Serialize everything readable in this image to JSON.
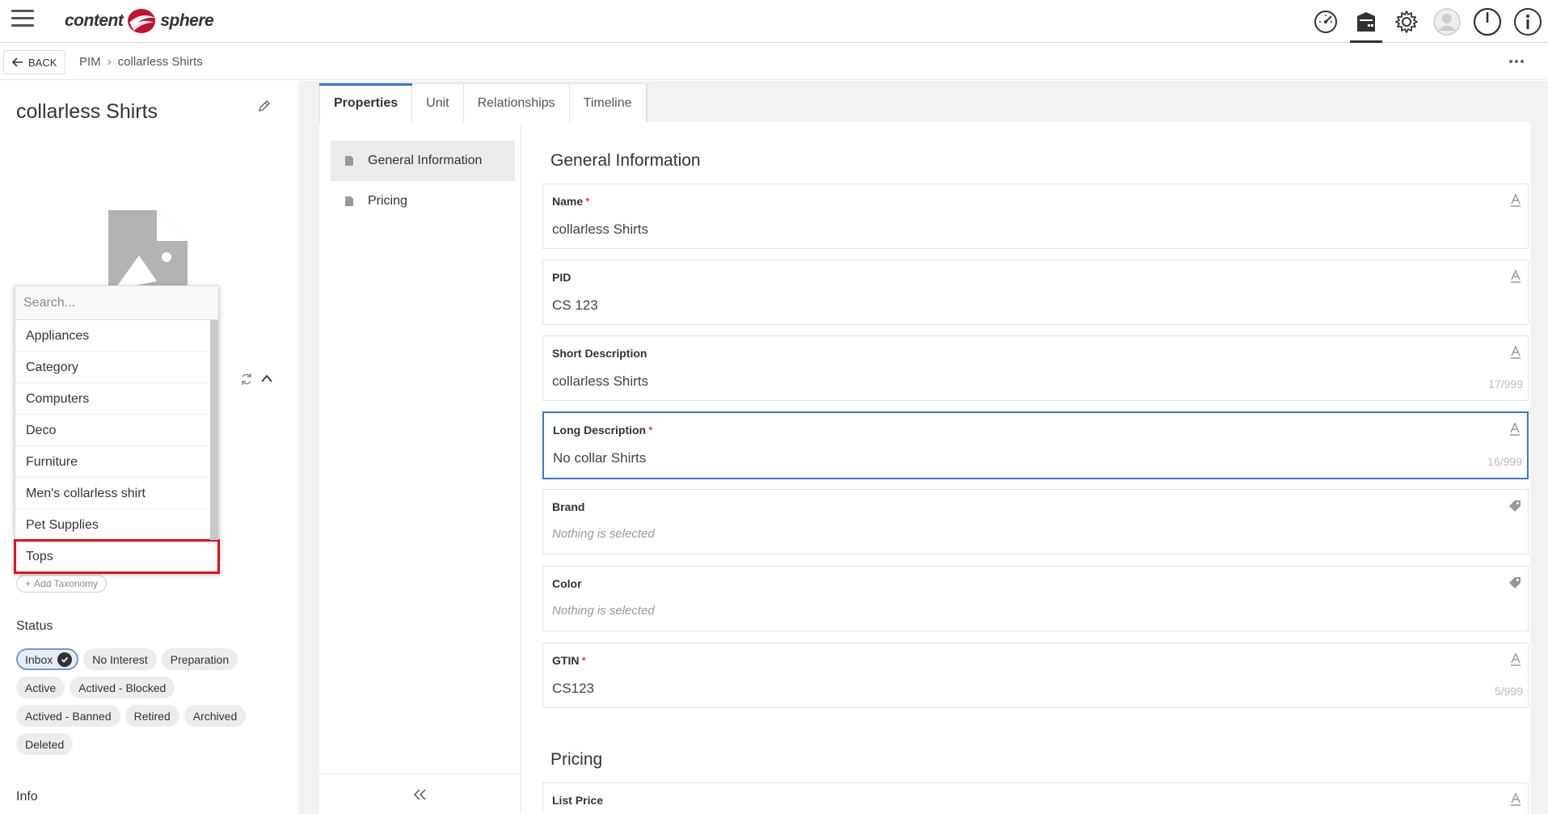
{
  "app": {
    "logo_left": "content",
    "logo_right": "sphere",
    "brand_color": "#c8102e"
  },
  "topbar": {
    "icons": [
      "dashboard-icon",
      "products-icon",
      "settings-icon",
      "user-icon",
      "power-icon",
      "info-icon"
    ],
    "active_icon": "products-icon"
  },
  "breadcrumb": {
    "back_label": "BACK",
    "items": [
      "PIM",
      "collarless Shirts"
    ]
  },
  "left": {
    "title": "collarless Shirts",
    "dropdown": {
      "placeholder": "Search...",
      "options": [
        "Appliances",
        "Category",
        "Computers",
        "Deco",
        "Furniture",
        "Men's collarless shirt",
        "Pet Supplies",
        "Tops"
      ],
      "highlighted": "Tops"
    },
    "add_taxonomy": "Add Taxonomy",
    "status_label": "Status",
    "statuses": [
      "Inbox",
      "No Interest",
      "Preparation",
      "Active",
      "Actived - Blocked",
      "Actived - Banned",
      "Retired",
      "Archived",
      "Deleted"
    ],
    "selected_status": "Inbox",
    "info_label": "Info"
  },
  "tabs": [
    "Properties",
    "Unit",
    "Relationships",
    "Timeline"
  ],
  "active_tab": "Properties",
  "subnav": [
    "General Information",
    "Pricing"
  ],
  "active_subnav": "General Information",
  "sections": {
    "general": "General Information",
    "pricing": "Pricing"
  },
  "fields": [
    {
      "label": "Name",
      "required": true,
      "value": "collarless Shirts",
      "counter": "",
      "icon": "text-icon"
    },
    {
      "label": "PID",
      "required": false,
      "value": "CS 123",
      "counter": "",
      "icon": "text-icon"
    },
    {
      "label": "Short Description",
      "required": false,
      "value": "collarless Shirts",
      "counter": "17/999",
      "icon": "text-icon"
    },
    {
      "label": "Long Description",
      "required": true,
      "value": "No collar Shirts",
      "counter": "16/999",
      "icon": "text-icon",
      "focused": true
    },
    {
      "label": "Brand",
      "required": false,
      "value": "Nothing is selected",
      "counter": "",
      "icon": "tag-icon",
      "empty": true
    },
    {
      "label": "Color",
      "required": false,
      "value": "Nothing is selected",
      "counter": "",
      "icon": "tag-icon",
      "empty": true
    },
    {
      "label": "GTIN",
      "required": true,
      "value": "CS123",
      "counter": "5/999",
      "icon": "text-icon"
    }
  ],
  "pricing_fields": [
    {
      "label": "List Price",
      "icon": "text-icon"
    }
  ],
  "colors": {
    "accent": "#3b73d8",
    "required": "#e0101e",
    "highlight_box": "#e0101e"
  }
}
